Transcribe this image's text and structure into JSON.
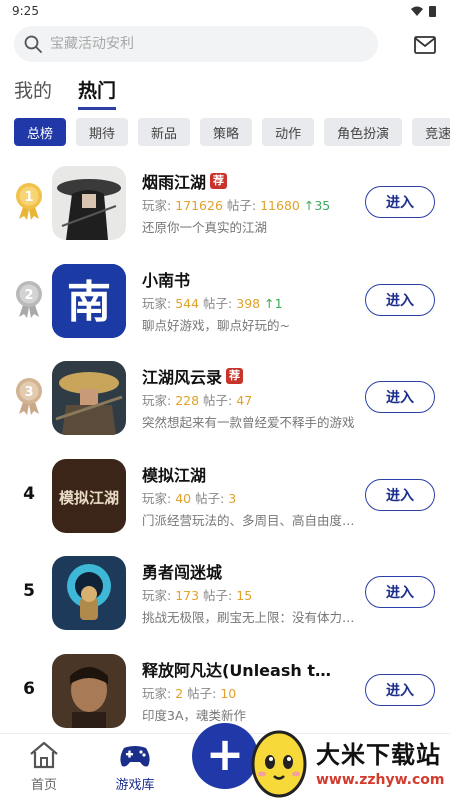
{
  "status_bar": {
    "time": "9:25"
  },
  "search": {
    "placeholder": "宝藏活动安利"
  },
  "top_tabs": [
    {
      "label": "我的",
      "active": false
    },
    {
      "label": "热门",
      "active": true
    }
  ],
  "categories": [
    "总榜",
    "期待",
    "新品",
    "策略",
    "动作",
    "角色扮演",
    "竞速"
  ],
  "active_category": "总榜",
  "games": [
    {
      "rank": "1",
      "name": "烟雨江湖",
      "recommended": true,
      "rec_label": "荐",
      "players_label": "玩家:",
      "players": "171626",
      "posts_label": "帖子:",
      "posts": "11680",
      "trend": "↑35",
      "desc": "还原你一个真实的江湖",
      "button": "进入"
    },
    {
      "rank": "2",
      "name": "小南书",
      "recommended": false,
      "players_label": "玩家:",
      "players": "544",
      "posts_label": "帖子:",
      "posts": "398",
      "trend": "↑1",
      "desc": "聊点好游戏，聊点好玩的~",
      "button": "进入"
    },
    {
      "rank": "3",
      "name": "江湖风云录",
      "recommended": true,
      "rec_label": "荐",
      "players_label": "玩家:",
      "players": "228",
      "posts_label": "帖子:",
      "posts": "47",
      "trend": "",
      "desc": "突然想起来有一款曾经爱不释手的游戏",
      "button": "进入"
    },
    {
      "rank": "4",
      "name": "模拟江湖",
      "recommended": false,
      "players_label": "玩家:",
      "players": "40",
      "posts_label": "帖子:",
      "posts": "3",
      "trend": "",
      "desc": "门派经营玩法的、多周目、高自由度的江湖",
      "button": "进入"
    },
    {
      "rank": "5",
      "name": "勇者闯迷城",
      "recommended": false,
      "players_label": "玩家:",
      "players": "173",
      "posts_label": "帖子:",
      "posts": "15",
      "trend": "",
      "desc": "挑战无极限，刷宝无上限：没有体力限制",
      "button": "进入"
    },
    {
      "rank": "6",
      "name": "释放阿凡达(Unleash the Avatar)",
      "recommended": false,
      "players_label": "玩家:",
      "players": "2",
      "posts_label": "帖子:",
      "posts": "10",
      "trend": "",
      "desc": "印度3A，魂类新作",
      "button": "进入"
    }
  ],
  "icon_text": {
    "xiaonanshu": "南",
    "moni": "模拟江湖"
  },
  "bottom_nav": {
    "home": "首页",
    "library": "游戏库"
  },
  "watermark": {
    "title": "大米下载站",
    "url": "www.zzhyw.com"
  },
  "colors": {
    "accent": "#2038a8",
    "gold": "#e0a22a",
    "up": "#3daa5c",
    "badge": "#c8342c"
  }
}
